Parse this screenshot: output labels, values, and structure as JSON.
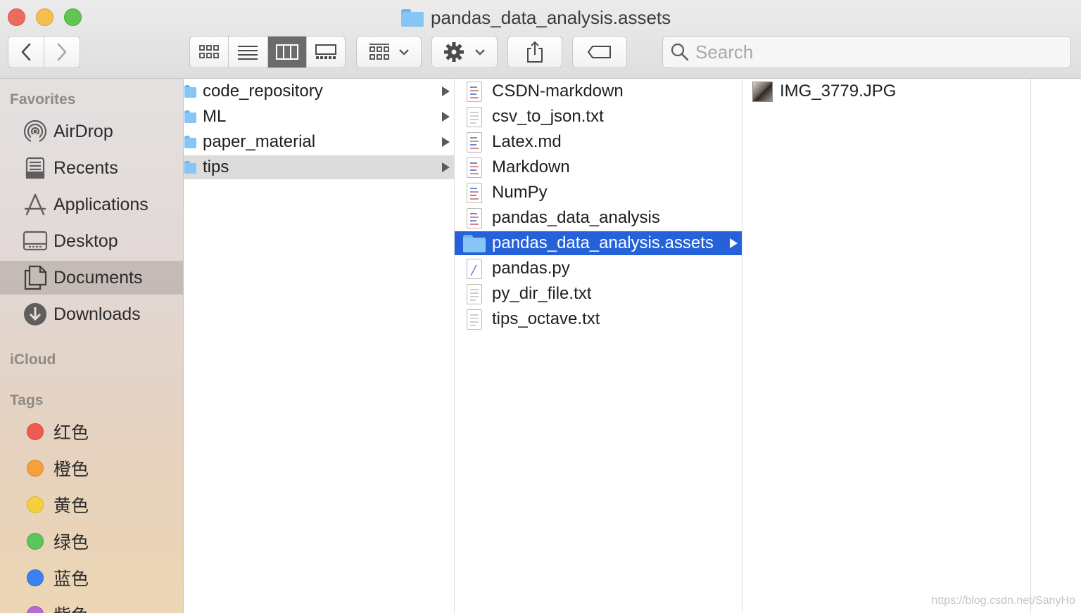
{
  "window": {
    "title": "pandas_data_analysis.assets",
    "search_placeholder": "Search"
  },
  "toolbar": {
    "view_modes": [
      "icon",
      "list",
      "column",
      "gallery"
    ],
    "active_view": "column"
  },
  "sidebar": {
    "favorites_heading": "Favorites",
    "favorites": [
      {
        "label": "AirDrop",
        "icon": "airdrop-icon"
      },
      {
        "label": "Recents",
        "icon": "recents-icon"
      },
      {
        "label": "Applications",
        "icon": "applications-icon"
      },
      {
        "label": "Desktop",
        "icon": "desktop-icon"
      },
      {
        "label": "Documents",
        "icon": "documents-icon",
        "selected": true
      },
      {
        "label": "Downloads",
        "icon": "downloads-icon"
      }
    ],
    "icloud_heading": "iCloud",
    "tags_heading": "Tags",
    "tags": [
      {
        "label": "红色",
        "color": "#ee5b52"
      },
      {
        "label": "橙色",
        "color": "#f5a03c"
      },
      {
        "label": "黄色",
        "color": "#f7cf3e"
      },
      {
        "label": "绿色",
        "color": "#5bc65b"
      },
      {
        "label": "蓝色",
        "color": "#3b82f0"
      },
      {
        "label": "紫色",
        "color": "#b56ad8"
      }
    ]
  },
  "columns": {
    "col1": [
      {
        "name": "code_repository",
        "type": "folder"
      },
      {
        "name": "ML",
        "type": "folder"
      },
      {
        "name": "paper_material",
        "type": "folder"
      },
      {
        "name": "tips",
        "type": "folder",
        "selected": true
      }
    ],
    "col2": [
      {
        "name": "CSDN-markdown",
        "type": "md"
      },
      {
        "name": "csv_to_json.txt",
        "type": "txt"
      },
      {
        "name": "Latex.md",
        "type": "md"
      },
      {
        "name": "Markdown",
        "type": "md"
      },
      {
        "name": "NumPy",
        "type": "md"
      },
      {
        "name": "pandas_data_analysis",
        "type": "md"
      },
      {
        "name": "pandas_data_analysis.assets",
        "type": "folder",
        "selected": true
      },
      {
        "name": "pandas.py",
        "type": "py"
      },
      {
        "name": "py_dir_file.txt",
        "type": "txt"
      },
      {
        "name": "tips_octave.txt",
        "type": "txt"
      }
    ],
    "col3": [
      {
        "name": "IMG_3779.JPG",
        "type": "image"
      }
    ]
  },
  "watermark": "https://blog.csdn.net/SanyHo"
}
